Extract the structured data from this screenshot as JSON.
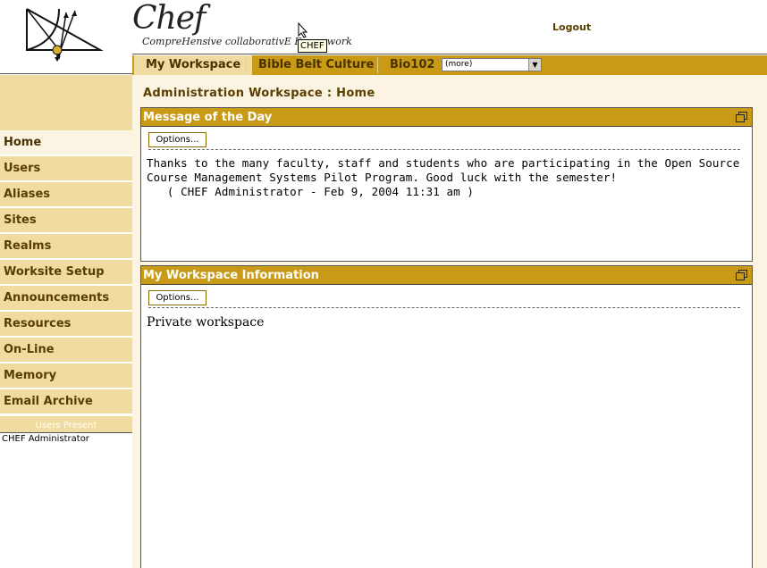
{
  "header": {
    "brand_title": "Chef",
    "brand_tagline": "CompreHensive collaborativE Framework",
    "logout_label": "Logout",
    "tooltip": "CHEF"
  },
  "tabs": [
    {
      "label": "My Workspace",
      "active": true
    },
    {
      "label": "Bible Belt Culture",
      "active": false
    },
    {
      "label": "Bio102",
      "active": false
    }
  ],
  "more_select": {
    "value": "(more)"
  },
  "sidebar": {
    "items": [
      {
        "label": "Home",
        "active": true
      },
      {
        "label": "Users"
      },
      {
        "label": "Aliases"
      },
      {
        "label": "Sites"
      },
      {
        "label": "Realms"
      },
      {
        "label": "Worksite Setup"
      },
      {
        "label": "Announcements"
      },
      {
        "label": "Resources"
      },
      {
        "label": "On-Line"
      },
      {
        "label": "Memory"
      },
      {
        "label": "Email Archive"
      }
    ],
    "users_present_label": "Users Present",
    "users_present": [
      "CHEF Administrator"
    ]
  },
  "main": {
    "breadcrumb": "Administration Workspace :  Home",
    "motd": {
      "title": "Message of the Day",
      "options_label": "Options...",
      "text": "Thanks to the many faculty, staff and students who are participating in the Open Source\nCourse Management Systems Pilot Program. Good luck with the semester!\n   ( CHEF Administrator - Feb 9, 2004 11:31 am )"
    },
    "info": {
      "title": "My Workspace Information",
      "options_label": "Options...",
      "text": "Private workspace"
    }
  },
  "colors": {
    "tab_bar": "#c99a16",
    "nav_bg": "#f0dca0",
    "content_bg": "#fbf4e2",
    "text_brown": "#5a3e00"
  }
}
